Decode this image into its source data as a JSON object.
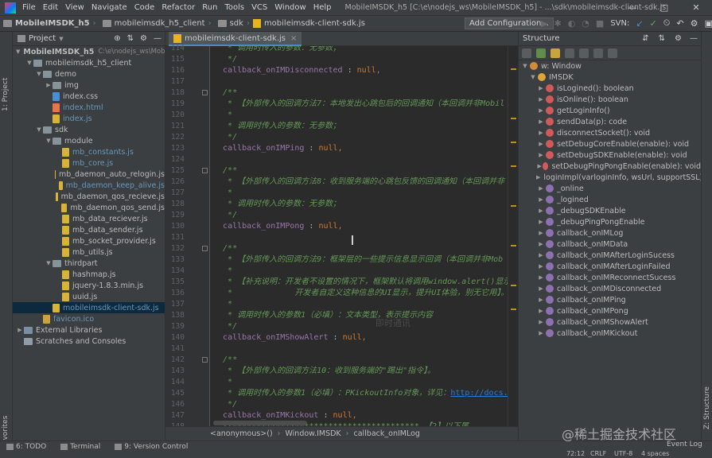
{
  "app": {
    "menu": [
      "File",
      "Edit",
      "View",
      "Navigate",
      "Code",
      "Refactor",
      "Run",
      "Tools",
      "VCS",
      "Window",
      "Help"
    ],
    "window_title": "MobileIMSDK_h5 [C:\\e\\nodejs_ws\\MobileIMSDK_h5] - ...\\sdk\\mobileimsdk-client-sdk.js",
    "window_controls": [
      "—",
      "□",
      "✕"
    ]
  },
  "navbar": {
    "crumbs": [
      "MobileIMSDK_h5",
      "mobileimsdk_h5_client",
      "sdk",
      "mobileimsdk-client-sdk.js"
    ],
    "add_config": "Add Configuration...",
    "svn": "SVN:"
  },
  "left_stripe": {
    "project_tab": "1: Project",
    "favorites_tab": "2: Favorites"
  },
  "project": {
    "header": "Project",
    "tree": [
      {
        "label": "MobileIMSDK_h5",
        "suffix": "C:\\e\\nodejs_ws\\MobileIMSDK_h5",
        "indent": 0,
        "arrow": "▼",
        "icon": "folder",
        "bold": true
      },
      {
        "label": "mobileimsdk_h5_client",
        "indent": 1,
        "arrow": "▼",
        "icon": "folder"
      },
      {
        "label": "demo",
        "indent": 2,
        "arrow": "▼",
        "icon": "folder"
      },
      {
        "label": "img",
        "indent": 3,
        "arrow": "▶",
        "icon": "folder"
      },
      {
        "label": "index.css",
        "indent": 3,
        "arrow": "",
        "icon": "css"
      },
      {
        "label": "index.html",
        "indent": 3,
        "arrow": "",
        "icon": "html",
        "blue": true
      },
      {
        "label": "index.js",
        "indent": 3,
        "arrow": "",
        "icon": "js",
        "blue": true
      },
      {
        "label": "sdk",
        "indent": 2,
        "arrow": "▼",
        "icon": "folder"
      },
      {
        "label": "module",
        "indent": 3,
        "arrow": "▼",
        "icon": "folder"
      },
      {
        "label": "mb_constants.js",
        "indent": 4,
        "arrow": "",
        "icon": "js",
        "blue": true
      },
      {
        "label": "mb_core.js",
        "indent": 4,
        "arrow": "",
        "icon": "js",
        "blue": true
      },
      {
        "label": "mb_daemon_auto_relogin.js",
        "indent": 4,
        "arrow": "",
        "icon": "js"
      },
      {
        "label": "mb_daemon_keep_alive.js",
        "indent": 4,
        "arrow": "",
        "icon": "js",
        "blue": true
      },
      {
        "label": "mb_daemon_qos_recieve.js",
        "indent": 4,
        "arrow": "",
        "icon": "js"
      },
      {
        "label": "mb_daemon_qos_send.js",
        "indent": 4,
        "arrow": "",
        "icon": "js"
      },
      {
        "label": "mb_data_reciever.js",
        "indent": 4,
        "arrow": "",
        "icon": "js"
      },
      {
        "label": "mb_data_sender.js",
        "indent": 4,
        "arrow": "",
        "icon": "js"
      },
      {
        "label": "mb_socket_provider.js",
        "indent": 4,
        "arrow": "",
        "icon": "js"
      },
      {
        "label": "mb_utils.js",
        "indent": 4,
        "arrow": "",
        "icon": "js"
      },
      {
        "label": "thirdpart",
        "indent": 3,
        "arrow": "▼",
        "icon": "folder"
      },
      {
        "label": "hashmap.js",
        "indent": 4,
        "arrow": "",
        "icon": "js"
      },
      {
        "label": "jquery-1.8.3.min.js",
        "indent": 4,
        "arrow": "",
        "icon": "js"
      },
      {
        "label": "uuid.js",
        "indent": 4,
        "arrow": "",
        "icon": "js"
      },
      {
        "label": "mobileimsdk-client-sdk.js",
        "indent": 3,
        "arrow": "",
        "icon": "js",
        "blue": true,
        "selected": true
      },
      {
        "label": "favicon.ico",
        "indent": 2,
        "arrow": "",
        "icon": "fav",
        "blue": true
      },
      {
        "label": "External Libraries",
        "indent": 0,
        "arrow": "▶",
        "icon": "lib"
      },
      {
        "label": "Scratches and Consoles",
        "indent": 0,
        "arrow": "",
        "icon": "scr"
      }
    ]
  },
  "editor": {
    "tab": "mobileimsdk-client-sdk.js",
    "lines": [
      {
        "n": "114",
        "segs": [
          {
            "t": "   * 调用时传入的参数：无参数；",
            "c": "cmi"
          }
        ]
      },
      {
        "n": "115",
        "segs": [
          {
            "t": "   */",
            "c": "cmi"
          }
        ]
      },
      {
        "n": "116",
        "segs": [
          {
            "t": "  ",
            "c": ""
          },
          {
            "t": "callback_onIMDisconnected",
            "c": "fld"
          },
          {
            "t": " : ",
            "c": ""
          },
          {
            "t": "null",
            "c": "kw"
          },
          {
            "t": ",",
            "c": "kw"
          }
        ]
      },
      {
        "n": "117",
        "segs": []
      },
      {
        "n": "118",
        "segs": [
          {
            "t": "  /**",
            "c": "cmi"
          }
        ]
      },
      {
        "n": "119",
        "segs": [
          {
            "t": "   * 【外部传入的回调方法7：本地发出心跳包后的回调通知（本回调并非Mobil",
            "c": "cmi"
          }
        ]
      },
      {
        "n": "120",
        "segs": [
          {
            "t": "   *",
            "c": "cmi"
          }
        ]
      },
      {
        "n": "121",
        "segs": [
          {
            "t": "   * 调用时传入的参数：无参数；",
            "c": "cmi"
          }
        ]
      },
      {
        "n": "122",
        "segs": [
          {
            "t": "   */",
            "c": "cmi"
          }
        ]
      },
      {
        "n": "123",
        "segs": [
          {
            "t": "  ",
            "c": ""
          },
          {
            "t": "callback_onIMPing",
            "c": "fld"
          },
          {
            "t": " : ",
            "c": ""
          },
          {
            "t": "null",
            "c": "kw"
          },
          {
            "t": ",",
            "c": "kw"
          }
        ]
      },
      {
        "n": "124",
        "segs": []
      },
      {
        "n": "125",
        "segs": [
          {
            "t": "  /**",
            "c": "cmi"
          }
        ]
      },
      {
        "n": "126",
        "segs": [
          {
            "t": "   * 【外部传入的回调方法8：收到服务端的心跳包反馈的回调通知（本回调并非",
            "c": "cmi"
          }
        ]
      },
      {
        "n": "127",
        "segs": [
          {
            "t": "   *",
            "c": "cmi"
          }
        ]
      },
      {
        "n": "128",
        "segs": [
          {
            "t": "   * 调用时传入的参数：无参数；",
            "c": "cmi"
          }
        ]
      },
      {
        "n": "129",
        "segs": [
          {
            "t": "   */",
            "c": "cmi"
          }
        ]
      },
      {
        "n": "130",
        "segs": [
          {
            "t": "  ",
            "c": ""
          },
          {
            "t": "callback_onIMPong",
            "c": "fld"
          },
          {
            "t": " : ",
            "c": ""
          },
          {
            "t": "null",
            "c": "kw"
          },
          {
            "t": ",",
            "c": "kw"
          }
        ]
      },
      {
        "n": "131",
        "segs": []
      },
      {
        "n": "132",
        "segs": [
          {
            "t": "  /**",
            "c": "cmi"
          }
        ]
      },
      {
        "n": "133",
        "segs": [
          {
            "t": "   * 【外部传入的回调方法9：框架层的一些提示信息显示回调（本回调并非Mob",
            "c": "cmi"
          }
        ]
      },
      {
        "n": "134",
        "segs": [
          {
            "t": "   *",
            "c": "cmi"
          }
        ]
      },
      {
        "n": "135",
        "segs": [
          {
            "t": "   * 【补充说明：开发者不设置的情况下，框架默认将调用window.alert()显示",
            "c": "cmi"
          }
        ]
      },
      {
        "n": "136",
        "segs": [
          {
            "t": "   *             开发者自定义这种信息的UI显示，提升UI体验，别无它用】。",
            "c": "cmi"
          }
        ]
      },
      {
        "n": "137",
        "segs": [
          {
            "t": "   *",
            "c": "cmi"
          }
        ]
      },
      {
        "n": "138",
        "segs": [
          {
            "t": "   * 调用时传入的参数1（必填）：文本类型，表示提示内容",
            "c": "cmi"
          }
        ]
      },
      {
        "n": "139",
        "segs": [
          {
            "t": "   */",
            "c": "cmi"
          }
        ]
      },
      {
        "n": "140",
        "segs": [
          {
            "t": "  ",
            "c": ""
          },
          {
            "t": "callback_onIMShowAlert",
            "c": "fld"
          },
          {
            "t": " : ",
            "c": ""
          },
          {
            "t": "null",
            "c": "kw"
          },
          {
            "t": ",",
            "c": "kw"
          }
        ]
      },
      {
        "n": "141",
        "segs": []
      },
      {
        "n": "142",
        "segs": [
          {
            "t": "  /**",
            "c": "cmi"
          }
        ]
      },
      {
        "n": "143",
        "segs": [
          {
            "t": "   * 【外部传入的回调方法10：收到服务端的\"踢出\"指令】。",
            "c": "cmi"
          }
        ]
      },
      {
        "n": "144",
        "segs": [
          {
            "t": "   *",
            "c": "cmi"
          }
        ]
      },
      {
        "n": "145",
        "segs": [
          {
            "t": "   * 调用时传入的参数1（必填）：PKickoutInfo对象，详见：",
            "c": "cmi"
          },
          {
            "t": "http://docs.5",
            "c": "lnk"
          }
        ]
      },
      {
        "n": "146",
        "segs": [
          {
            "t": "   */",
            "c": "cmi"
          }
        ]
      },
      {
        "n": "147",
        "segs": [
          {
            "t": "  ",
            "c": ""
          },
          {
            "t": "callback_onIMKickout",
            "c": "fld"
          },
          {
            "t": " : ",
            "c": ""
          },
          {
            "t": "null",
            "c": "kw"
          },
          {
            "t": ",",
            "c": "kw"
          }
        ]
      },
      {
        "n": "148",
        "segs": [
          {
            "t": "  //*************************************** 【2】以下属",
            "c": "cmi"
          }
        ]
      },
      {
        "n": "149",
        "segs": []
      }
    ],
    "breadcrumb": [
      "<anonymous>()",
      "Window.IMSDK",
      "callback_onIMLog"
    ],
    "overlay_mark": "即时通讯"
  },
  "structure": {
    "header": "Structure",
    "items": [
      {
        "label": "w: Window",
        "indent": 0,
        "arrow": "▼",
        "kind": "v"
      },
      {
        "label": "IMSDK",
        "indent": 1,
        "arrow": "▼",
        "kind": "c"
      },
      {
        "label": "isLogined(): boolean",
        "indent": 2,
        "arrow": "▶",
        "kind": "m"
      },
      {
        "label": "isOnline(): boolean",
        "indent": 2,
        "arrow": "▶",
        "kind": "m"
      },
      {
        "label": "getLoginInfo()",
        "indent": 2,
        "arrow": "▶",
        "kind": "m"
      },
      {
        "label": "sendData(p): code",
        "indent": 2,
        "arrow": "▶",
        "kind": "m"
      },
      {
        "label": "disconnectSocket(): void",
        "indent": 2,
        "arrow": "▶",
        "kind": "m"
      },
      {
        "label": "setDebugCoreEnable(enable): void",
        "indent": 2,
        "arrow": "▶",
        "kind": "m"
      },
      {
        "label": "setDebugSDKEnable(enable): void",
        "indent": 2,
        "arrow": "▶",
        "kind": "m"
      },
      {
        "label": "setDebugPingPongEnable(enable): void",
        "indent": 2,
        "arrow": "▶",
        "kind": "m"
      },
      {
        "label": "loginImpl(varloginInfo, wsUrl, supportSSL): void",
        "indent": 2,
        "arrow": "▶",
        "kind": "m"
      },
      {
        "label": "_online",
        "indent": 2,
        "arrow": "▶",
        "kind": "f"
      },
      {
        "label": "_logined",
        "indent": 2,
        "arrow": "▶",
        "kind": "f"
      },
      {
        "label": "_debugSDKEnable",
        "indent": 2,
        "arrow": "▶",
        "kind": "f"
      },
      {
        "label": "_debugPingPongEnable",
        "indent": 2,
        "arrow": "▶",
        "kind": "f"
      },
      {
        "label": "callback_onIMLog",
        "indent": 2,
        "arrow": "▶",
        "kind": "f"
      },
      {
        "label": "callback_onIMData",
        "indent": 2,
        "arrow": "▶",
        "kind": "f"
      },
      {
        "label": "callback_onIMAfterLoginSucess",
        "indent": 2,
        "arrow": "▶",
        "kind": "f"
      },
      {
        "label": "callback_onIMAfterLoginFailed",
        "indent": 2,
        "arrow": "▶",
        "kind": "f"
      },
      {
        "label": "callback_onIMReconnectSucess",
        "indent": 2,
        "arrow": "▶",
        "kind": "f"
      },
      {
        "label": "callback_onIMDisconnected",
        "indent": 2,
        "arrow": "▶",
        "kind": "f"
      },
      {
        "label": "callback_onIMPing",
        "indent": 2,
        "arrow": "▶",
        "kind": "f"
      },
      {
        "label": "callback_onIMPong",
        "indent": 2,
        "arrow": "▶",
        "kind": "f"
      },
      {
        "label": "callback_onIMShowAlert",
        "indent": 2,
        "arrow": "▶",
        "kind": "f"
      },
      {
        "label": "callback_onIMKickout",
        "indent": 2,
        "arrow": "▶",
        "kind": "f"
      }
    ]
  },
  "right_stripe": {
    "structure_tab": "Z: Structure"
  },
  "bottom": {
    "todo": "6: TODO",
    "terminal": "Terminal",
    "version_control": "9: Version Control",
    "event_log": "Event Log",
    "status": {
      "position": "72:12",
      "line_sep": "CRLF",
      "encoding": "UTF-8",
      "indent": "4 spaces"
    }
  },
  "watermark": "@稀土掘金技术社区",
  "colors": {
    "accent": "#4a88c7",
    "comment": "#629755",
    "keyword": "#cc7832",
    "field": "#9876aa"
  }
}
